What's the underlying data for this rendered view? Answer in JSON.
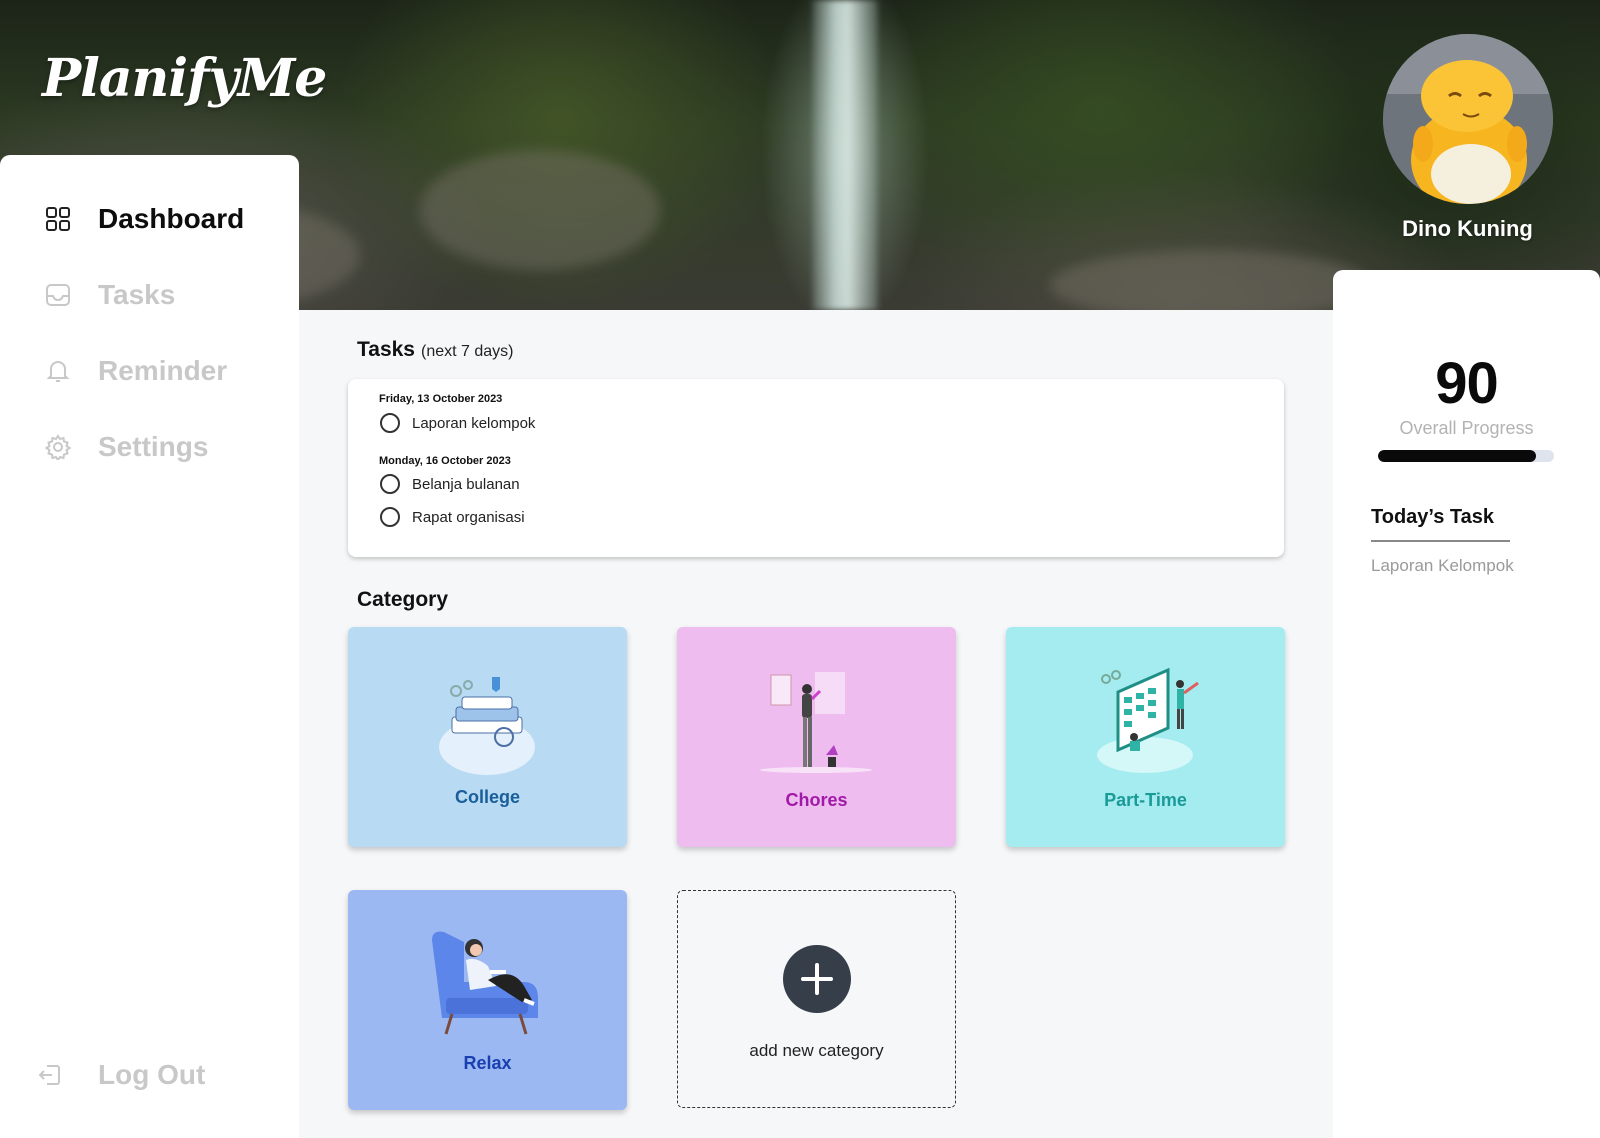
{
  "app": {
    "name": "PlanifyMe"
  },
  "sidebar": {
    "items": [
      {
        "label": "Dashboard",
        "icon": "grid-icon",
        "active": true
      },
      {
        "label": "Tasks",
        "icon": "inbox-icon",
        "active": false
      },
      {
        "label": "Reminder",
        "icon": "bell-icon",
        "active": false
      },
      {
        "label": "Settings",
        "icon": "gear-icon",
        "active": false
      }
    ],
    "logout": {
      "label": "Log Out",
      "icon": "logout-icon"
    }
  },
  "tasks": {
    "title": "Tasks",
    "subtitle": "(next 7 days)",
    "groups": [
      {
        "date": "Friday, 13 October 2023",
        "items": [
          "Laporan kelompok"
        ]
      },
      {
        "date": "Monday, 16 October 2023",
        "items": [
          "Belanja bulanan",
          "Rapat organisasi"
        ]
      }
    ]
  },
  "category": {
    "title": "Category",
    "items": [
      {
        "name": "College",
        "bg": "#b8daf2",
        "color": "#1a5e9a"
      },
      {
        "name": "Chores",
        "bg": "#eebcef",
        "color": "#a01aa8"
      },
      {
        "name": "Part-Time",
        "bg": "#a4ecef",
        "color": "#1a9a98"
      },
      {
        "name": "Relax",
        "bg": "#9cb8f2",
        "color": "#1a3fb0"
      }
    ],
    "add_label": "add new category"
  },
  "profile": {
    "name": "Dino Kuning",
    "progress": 90,
    "progress_fraction": 0.9,
    "progress_label": "Overall Progress",
    "today_title": "Today’s Task",
    "today_items": [
      "Laporan Kelompok"
    ]
  },
  "colors": {
    "accent": "#0a0a0a",
    "muted_nav": "#c8c8c8",
    "panel_bg": "#ffffff",
    "page_bg": "#f6f7f9"
  }
}
